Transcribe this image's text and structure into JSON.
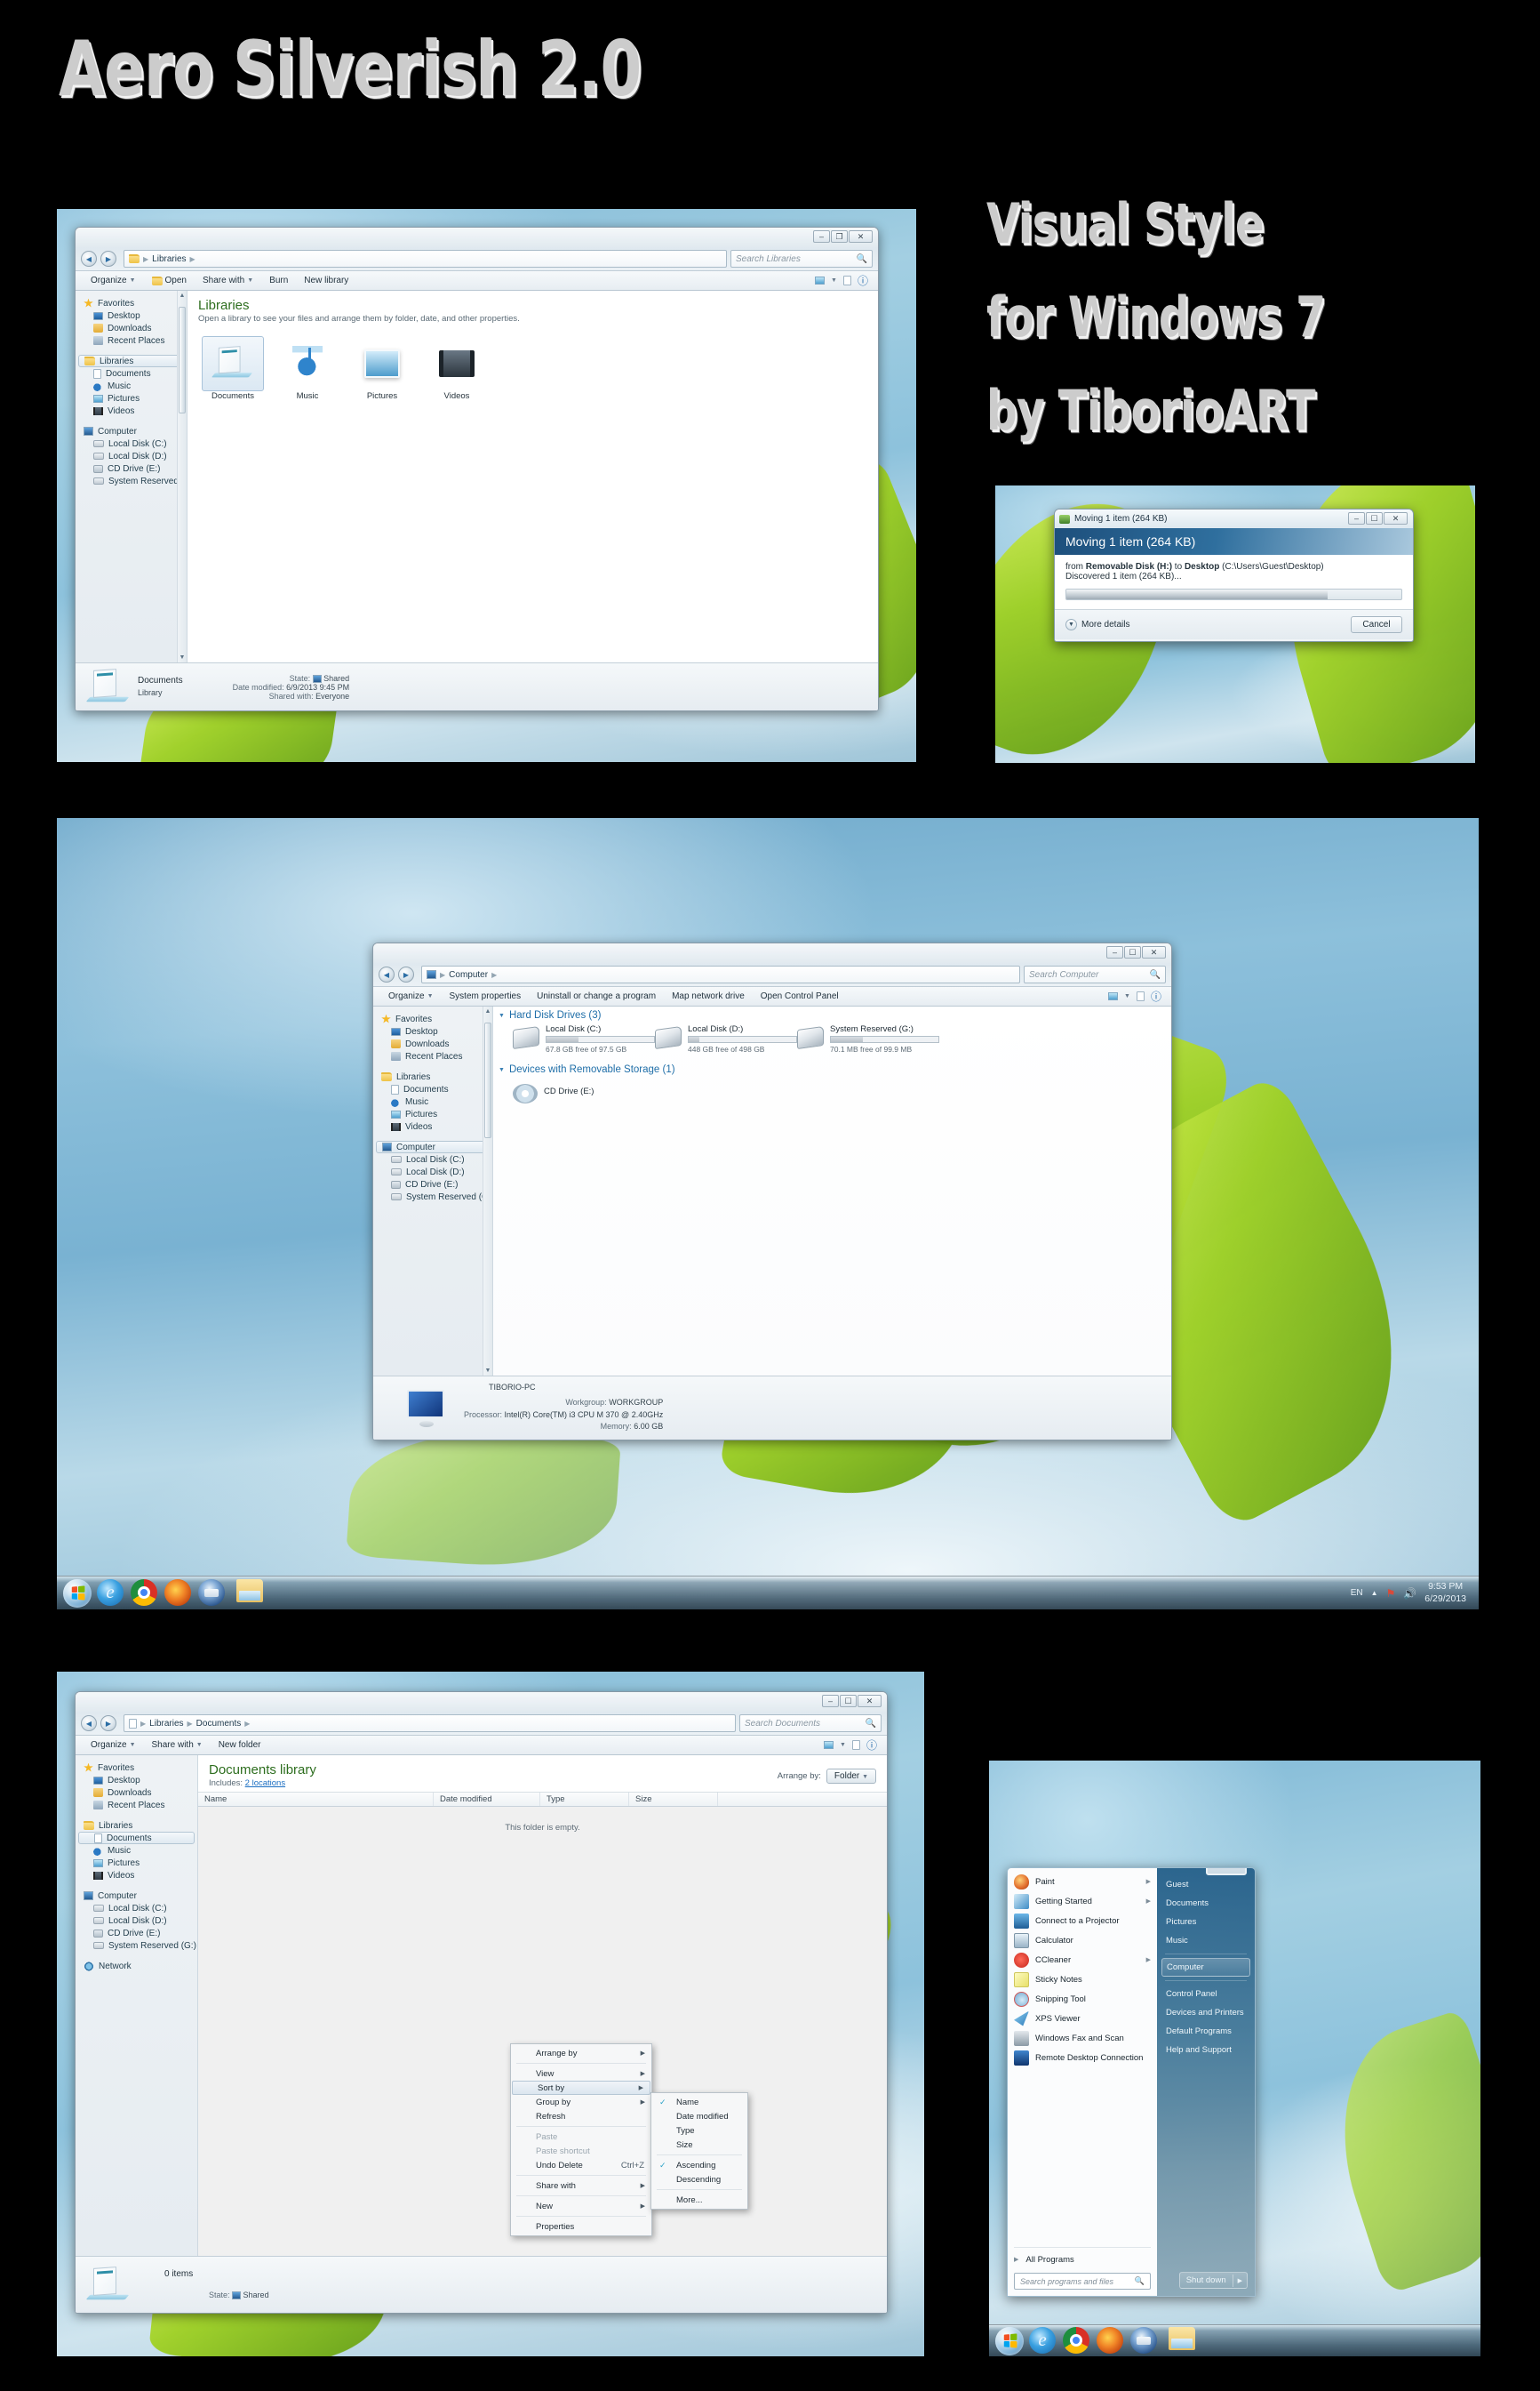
{
  "promo": {
    "title": "Aero Silverish 2.0",
    "line1": "Visual Style",
    "line2": "for Windows 7",
    "line3": "by TiborioART"
  },
  "window_libraries": {
    "titlebar": {
      "minimize": "–",
      "maximize": "❐",
      "close": "✕"
    },
    "breadcrumb": [
      "Libraries"
    ],
    "search_placeholder": "Search Libraries",
    "search_icon": "search-icon",
    "toolbar": [
      "Organize",
      "Open",
      "Share with",
      "Burn",
      "New library"
    ],
    "nav": {
      "groups": [
        {
          "header": "Favorites",
          "icon": "star-icon",
          "items": [
            "Desktop",
            "Downloads",
            "Recent Places"
          ]
        },
        {
          "header": "Libraries",
          "icon": "folder-icon",
          "selected": true,
          "items": [
            "Documents",
            "Music",
            "Pictures",
            "Videos"
          ]
        },
        {
          "header": "Computer",
          "icon": "computer-icon",
          "items": [
            "Local Disk (C:)",
            "Local Disk (D:)",
            "CD Drive (E:)",
            "System Reserved (G:)"
          ]
        }
      ]
    },
    "heading": "Libraries",
    "subheading": "Open a library to see your files and arrange them by folder, date, and other properties.",
    "tiles": [
      {
        "label": "Documents",
        "selected": true
      },
      {
        "label": "Music",
        "selected": false
      },
      {
        "label": "Pictures",
        "selected": false
      },
      {
        "label": "Videos",
        "selected": false
      }
    ],
    "details": {
      "name": "Documents",
      "type": "Library",
      "state_label": "State:",
      "state_value": "Shared",
      "date_label": "Date modified:",
      "date_value": "6/9/2013 9:45 PM",
      "shared_label": "Shared with:",
      "shared_value": "Everyone"
    }
  },
  "dialog_moving": {
    "titlebar_text": "Moving 1 item (264 KB)",
    "banner": "Moving 1 item (264 KB)",
    "line1_prefix": "from ",
    "line1_source": "Removable Disk (H:)",
    "line1_mid": " to ",
    "line1_dest": "Desktop",
    "line1_path": " (C:\\Users\\Guest\\Desktop)",
    "line2": "Discovered 1 item (264 KB)...",
    "more_details": "More details",
    "cancel": "Cancel",
    "progress_percent": 78
  },
  "window_computer": {
    "breadcrumb": [
      "Computer"
    ],
    "search_placeholder": "Search Computer",
    "toolbar": [
      "Organize",
      "System properties",
      "Uninstall or change a program",
      "Map network drive",
      "Open Control Panel"
    ],
    "nav": {
      "groups": [
        {
          "header": "Favorites",
          "items": [
            "Desktop",
            "Downloads",
            "Recent Places"
          ]
        },
        {
          "header": "Libraries",
          "items": [
            "Documents",
            "Music",
            "Pictures",
            "Videos"
          ]
        },
        {
          "header": "Computer",
          "selected": true,
          "items": [
            "Local Disk (C:)",
            "Local Disk (D:)",
            "CD Drive (E:)",
            "System Reserved (G:)"
          ]
        }
      ]
    },
    "group_hdd": "Hard Disk Drives (3)",
    "drives": [
      {
        "name": "Local Disk (C:)",
        "free": "67.8 GB free of 97.5 GB",
        "used_percent": 30
      },
      {
        "name": "Local Disk (D:)",
        "free": "448 GB free of 498 GB",
        "used_percent": 10
      },
      {
        "name": "System Reserved (G:)",
        "free": "70.1 MB free of 99.9 MB",
        "used_percent": 30
      }
    ],
    "group_removable": "Devices with Removable Storage (1)",
    "removable": [
      {
        "name": "CD Drive (E:)"
      }
    ],
    "sysinfo": {
      "pc_name": "TIBORIO-PC",
      "workgroup_label": "Workgroup:",
      "workgroup_value": "WORKGROUP",
      "processor_label": "Processor:",
      "processor_value": "Intel(R) Core(TM) i3 CPU     M 370  @ 2.40GHz",
      "memory_label": "Memory:",
      "memory_value": "6.00 GB"
    }
  },
  "taskbar": {
    "start_icon": "windows-orb-icon",
    "pinned": [
      "internet-explorer-icon",
      "google-chrome-icon",
      "firefox-icon",
      "thunderbird-icon",
      "windows-explorer-icon"
    ],
    "language": "EN",
    "tray_icons": [
      "show-hidden-icons",
      "security-icon",
      "volume-icon"
    ],
    "time": "9:53 PM",
    "date": "6/29/2013"
  },
  "window_documents": {
    "breadcrumb": [
      "Libraries",
      "Documents"
    ],
    "search_placeholder": "Search Documents",
    "toolbar": [
      "Organize",
      "Share with",
      "New folder"
    ],
    "nav": {
      "groups": [
        {
          "header": "Favorites",
          "items": [
            "Desktop",
            "Downloads",
            "Recent Places"
          ]
        },
        {
          "header": "Libraries",
          "items": [
            "Documents",
            "Music",
            "Pictures",
            "Videos"
          ],
          "selected_child": "Documents"
        },
        {
          "header": "Computer",
          "items": [
            "Local Disk (C:)",
            "Local Disk (D:)",
            "CD Drive (E:)",
            "System Reserved (G:)"
          ]
        },
        {
          "header": "Network",
          "items": []
        }
      ]
    },
    "heading": "Documents library",
    "includes_label": "Includes:",
    "includes_value": "2 locations",
    "arrange_label": "Arrange by:",
    "arrange_value": "Folder",
    "columns": [
      "Name",
      "Date modified",
      "Type",
      "Size"
    ],
    "empty_text": "This folder is empty.",
    "status_count": "0 items",
    "status_state_label": "State:",
    "status_state_value": "Shared"
  },
  "context_menu": {
    "items": [
      {
        "label": "Arrange by",
        "submenu": true
      },
      {
        "label": "View",
        "submenu": true
      },
      {
        "label": "Sort by",
        "submenu": true,
        "selected": true
      },
      {
        "label": "Group by",
        "submenu": true
      },
      {
        "label": "Refresh",
        "submenu": false
      },
      {
        "separator": true
      },
      {
        "label": "Paste",
        "disabled": true
      },
      {
        "label": "Paste shortcut",
        "disabled": true
      },
      {
        "label": "Undo Delete",
        "accel": "Ctrl+Z"
      },
      {
        "separator": true
      },
      {
        "label": "Share with",
        "submenu": true
      },
      {
        "separator": true
      },
      {
        "label": "New",
        "submenu": true
      },
      {
        "separator": true
      },
      {
        "label": "Properties"
      }
    ],
    "submenu": [
      {
        "label": "Name",
        "checked": true
      },
      {
        "label": "Date modified"
      },
      {
        "label": "Type"
      },
      {
        "label": "Size"
      },
      {
        "separator": true
      },
      {
        "label": "Ascending",
        "checked": true
      },
      {
        "label": "Descending"
      },
      {
        "separator": true
      },
      {
        "label": "More..."
      }
    ]
  },
  "start_menu": {
    "programs": [
      {
        "label": "Paint",
        "icon": "paint-icon",
        "submenu": true
      },
      {
        "label": "Getting Started",
        "icon": "getting-started-icon",
        "submenu": true
      },
      {
        "label": "Connect to a Projector",
        "icon": "projector-icon"
      },
      {
        "label": "Calculator",
        "icon": "calculator-icon"
      },
      {
        "label": "CCleaner",
        "icon": "ccleaner-icon",
        "submenu": true
      },
      {
        "label": "Sticky Notes",
        "icon": "sticky-notes-icon"
      },
      {
        "label": "Snipping Tool",
        "icon": "snipping-tool-icon"
      },
      {
        "label": "XPS Viewer",
        "icon": "xps-viewer-icon"
      },
      {
        "label": "Windows Fax and Scan",
        "icon": "fax-scan-icon"
      },
      {
        "label": "Remote Desktop Connection",
        "icon": "remote-desktop-icon"
      }
    ],
    "all_programs": "All Programs",
    "search_placeholder": "Search programs and files",
    "right_items": [
      {
        "label": "Guest"
      },
      {
        "label": "Documents"
      },
      {
        "label": "Pictures"
      },
      {
        "label": "Music"
      },
      {
        "label": "Computer",
        "selected": true
      },
      {
        "label": "Control Panel"
      },
      {
        "label": "Devices and Printers"
      },
      {
        "label": "Default Programs"
      },
      {
        "label": "Help and Support"
      }
    ],
    "shutdown": "Shut down"
  },
  "colors": {
    "accent_blue": "#1f6ea8",
    "library_green": "#2e6e1f",
    "link_blue": "#1b6ec2"
  }
}
